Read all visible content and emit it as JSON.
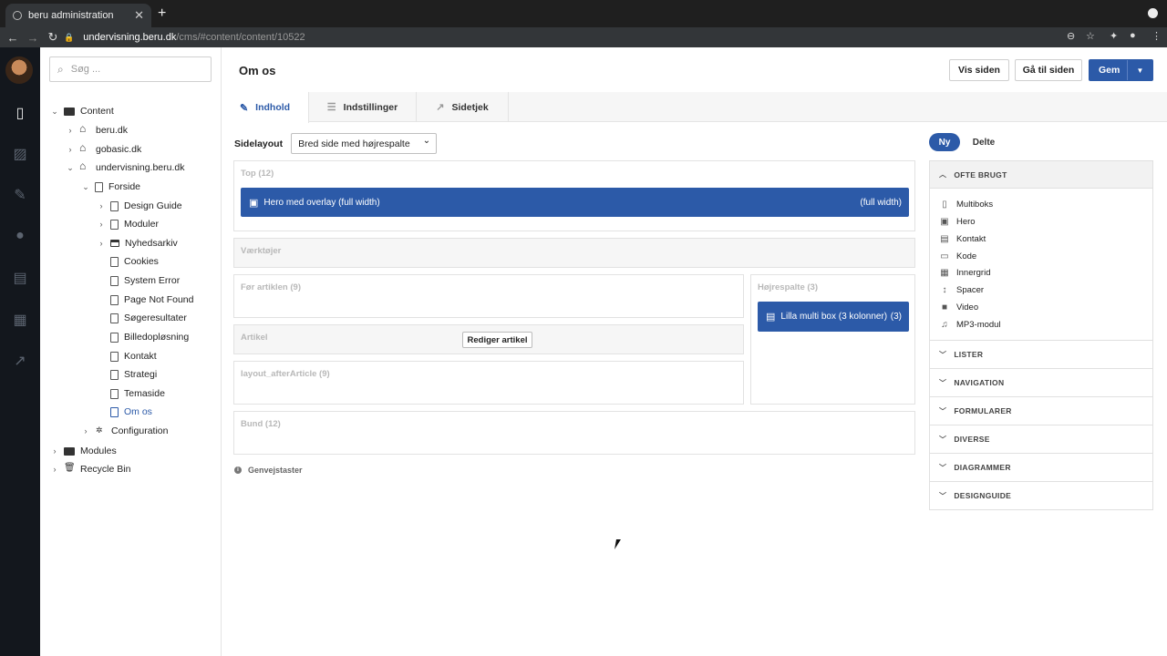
{
  "browser": {
    "tab_title": "beru administration",
    "url_host": "undervisning.beru.dk",
    "url_path": "/cms/#content/content/10522"
  },
  "search": {
    "placeholder": "Søg ..."
  },
  "tree": {
    "content": "Content",
    "beru": "beru.dk",
    "gobasic": "gobasic.dk",
    "undervisning": "undervisning.beru.dk",
    "forside": "Forside",
    "design_guide": "Design Guide",
    "moduler": "Moduler",
    "nyhedsarkiv": "Nyhedsarkiv",
    "cookies": "Cookies",
    "system_error": "System Error",
    "page_not_found": "Page Not Found",
    "soegeresultater": "Søgeresultater",
    "billedoploesning": "Billedopløsning",
    "kontakt": "Kontakt",
    "strategi": "Strategi",
    "temaside": "Temaside",
    "om_os": "Om os",
    "configuration": "Configuration",
    "modules": "Modules",
    "recycle_bin": "Recycle Bin"
  },
  "header": {
    "title": "Om os",
    "vis_siden": "Vis siden",
    "gaa_til_siden": "Gå til siden",
    "gem": "Gem"
  },
  "tabs": {
    "indhold": "Indhold",
    "indstillinger": "Indstillinger",
    "sidetjek": "Sidetjek"
  },
  "layout": {
    "label": "Sidelayout",
    "selected": "Bred side med højrespalte"
  },
  "zones": {
    "top": "Top (12)",
    "hero_block": "Hero med overlay (full width)",
    "hero_block_right": "(full width)",
    "vaerktoejer": "Værktøjer",
    "foer_artiklen": "Før artiklen (9)",
    "hoejrespalte": "Højrespalte (3)",
    "lilla_block": "Lilla multi box (3 kolonner)",
    "lilla_block_right": "(3)",
    "artikel": "Artikel",
    "rediger_artikel": "Rediger artikel",
    "after_article": "layout_afterArticle (9)",
    "bund": "Bund (12)",
    "genvejstaster": "Genvejstaster"
  },
  "panel": {
    "ny": "Ny",
    "delte": "Delte",
    "ofte_brugt": "OFTE BRUGT",
    "widgets": [
      "Multiboks",
      "Hero",
      "Kontakt",
      "Kode",
      "Innergrid",
      "Spacer",
      "Video",
      "MP3-modul"
    ],
    "sections": [
      "LISTER",
      "NAVIGATION",
      "FORMULARER",
      "DIVERSE",
      "DIAGRAMMER",
      "DESIGNGUIDE"
    ]
  },
  "colors": {
    "accent": "#2c5aa8",
    "rail": "#13171d"
  }
}
